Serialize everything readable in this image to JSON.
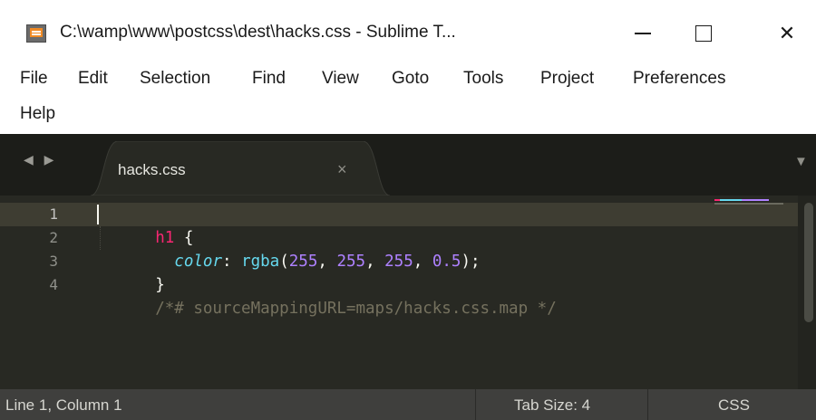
{
  "window": {
    "title": "C:\\wamp\\www\\postcss\\dest\\hacks.css - Sublime T...",
    "minimize_icon": "minimize-icon",
    "maximize_icon": "maximize-icon",
    "close_icon": "close-icon",
    "close_glyph": "✕"
  },
  "menu": {
    "items": [
      "File",
      "Edit",
      "Selection",
      "Find",
      "View",
      "Goto",
      "Tools",
      "Project",
      "Preferences",
      "Help"
    ]
  },
  "tabs": {
    "nav_glyph": "◀ ▶",
    "items": [
      {
        "label": "hacks.css",
        "close_glyph": "×",
        "active": true
      }
    ],
    "dropdown_glyph": "▼"
  },
  "editor": {
    "line_numbers": [
      "1",
      "2",
      "3",
      "4"
    ],
    "current_line": 1,
    "lines": [
      [
        {
          "text": "h1",
          "type": "tag"
        },
        {
          "text": " {",
          "type": "plain"
        }
      ],
      [
        {
          "text": "  ",
          "type": "plain"
        },
        {
          "text": "color",
          "type": "prop"
        },
        {
          "text": ": ",
          "type": "plain"
        },
        {
          "text": "rgba",
          "type": "fn"
        },
        {
          "text": "(",
          "type": "plain"
        },
        {
          "text": "255",
          "type": "num"
        },
        {
          "text": ", ",
          "type": "plain"
        },
        {
          "text": "255",
          "type": "num"
        },
        {
          "text": ", ",
          "type": "plain"
        },
        {
          "text": "255",
          "type": "num"
        },
        {
          "text": ", ",
          "type": "plain"
        },
        {
          "text": "0.5",
          "type": "num"
        },
        {
          "text": ");",
          "type": "plain"
        }
      ],
      [
        {
          "text": "}",
          "type": "plain"
        }
      ],
      [
        {
          "text": "/*# sourceMappingURL=maps/hacks.css.map */",
          "type": "comment"
        }
      ]
    ]
  },
  "status": {
    "position": "Line 1, Column 1",
    "tab_size": "Tab Size: 4",
    "syntax": "CSS"
  },
  "colors": {
    "editor_bg": "#282923",
    "current_line_bg": "#3e3d32",
    "tag": "#f92672",
    "property": "#66d9ef",
    "number": "#ae81ff",
    "comment": "#75715e",
    "status_bg": "#3f3f3d"
  }
}
